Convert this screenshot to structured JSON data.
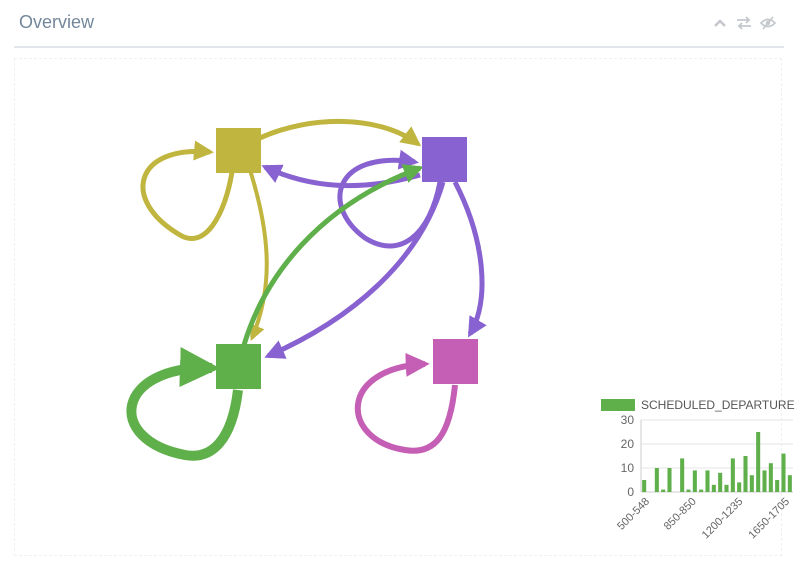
{
  "panel": {
    "title": "Overview",
    "tools": [
      {
        "name": "chevron-up-icon",
        "action": "collapse"
      },
      {
        "name": "swap-arrows-icon",
        "action": "swap"
      },
      {
        "name": "eye-slash-icon",
        "action": "hide"
      }
    ]
  },
  "graph": {
    "nodes": [
      {
        "id": "olive",
        "color": "#c0b53e"
      },
      {
        "id": "purple",
        "color": "#8862d0"
      },
      {
        "id": "green",
        "color": "#5faf4a"
      },
      {
        "id": "magenta",
        "color": "#c55fb5"
      }
    ]
  },
  "chart_data": {
    "type": "bar",
    "legend_label": "SCHEDULED_DEPARTURE",
    "color": "#5faf4a",
    "ylim": [
      0,
      30
    ],
    "yticks": [
      0,
      10,
      20,
      30
    ],
    "xtick_labels": [
      "500-548",
      "850-850",
      "1200-1235",
      "1650-1705"
    ],
    "values": [
      5,
      0,
      10,
      1,
      10,
      0,
      14,
      1,
      9,
      1,
      9,
      3,
      8,
      3,
      14,
      4,
      15,
      7,
      25,
      9,
      12,
      5,
      16,
      7
    ]
  }
}
